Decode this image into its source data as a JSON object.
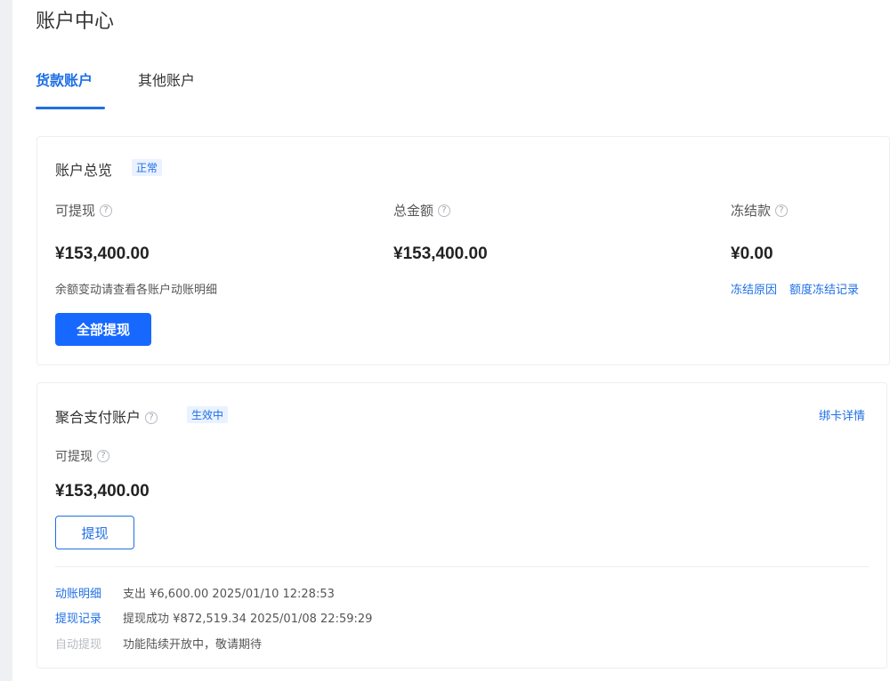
{
  "page": {
    "title": "账户中心"
  },
  "tabs": [
    {
      "label": "货款账户",
      "active": true
    },
    {
      "label": "其他账户",
      "active": false
    }
  ],
  "overview": {
    "title": "账户总览",
    "status": "正常",
    "withdrawable_label": "可提现",
    "withdrawable_amount": "¥153,400.00",
    "total_label": "总金额",
    "total_amount": "¥153,400.00",
    "frozen_label": "冻结款",
    "frozen_amount": "¥0.00",
    "hint": "余额变动请查看各账户动账明细",
    "frozen_reason_link": "冻结原因",
    "frozen_record_link": "额度冻结记录",
    "withdraw_all_button": "全部提现"
  },
  "aggregate": {
    "title": "聚合支付账户",
    "status": "生效中",
    "card_detail_link": "绑卡详情",
    "withdrawable_label": "可提现",
    "withdrawable_amount": "¥153,400.00",
    "withdraw_button": "提现",
    "records": [
      {
        "link": "动账明细",
        "text": "支出 ¥6,600.00 2025/01/10 12:28:53",
        "enabled": true
      },
      {
        "link": "提现记录",
        "text": "提现成功 ¥872,519.34 2025/01/08 22:59:29",
        "enabled": true
      },
      {
        "link": "自动提现",
        "text": "功能陆续开放中，敬请期待",
        "enabled": false
      }
    ]
  },
  "icons": {
    "help": "help-circle-icon"
  },
  "colors": {
    "accent": "#1f6fe5",
    "primary_button": "#1668ff",
    "badge_bg": "#eaf2ff"
  }
}
